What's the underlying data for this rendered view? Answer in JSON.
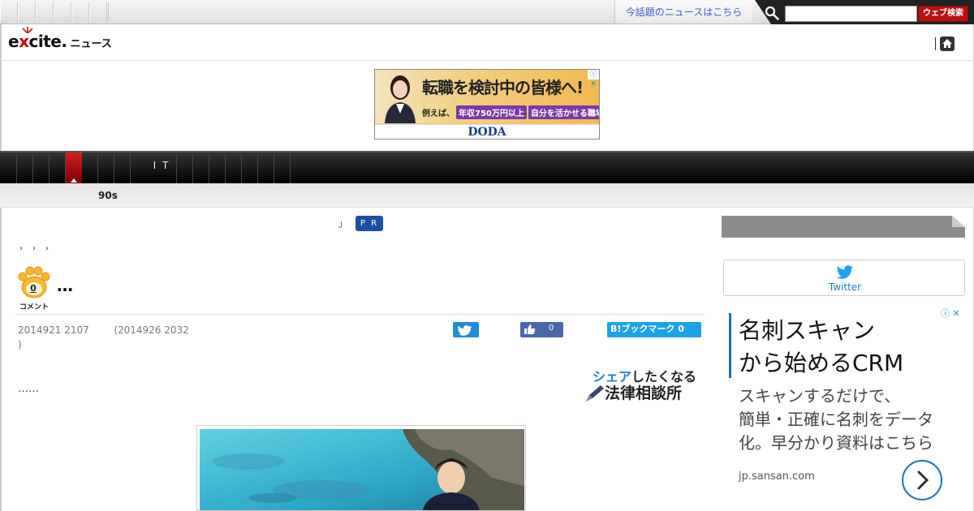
{
  "topbar": {
    "news_link": "今話題のニュースはこちら",
    "search_placeholder": "",
    "search_button": "ウェブ検索"
  },
  "logo": {
    "brand_pre": "e",
    "brand_x": "x",
    "brand_post": "cite",
    "brand_dot": ".",
    "section": "ニュース"
  },
  "banner": {
    "headline": "転職を検討中の皆様へ!",
    "sub_prefix": "例えば、",
    "sub_pill1": "年収750万円以上",
    "sub_pill2": "自分を活かせる職場",
    "brand": "DODA",
    "adchoice": "ⓘ ✕"
  },
  "nav": {
    "it_label": "I T"
  },
  "subnav": {
    "item": "90s"
  },
  "article": {
    "pr_mark": "┘",
    "pr_badge": "P R",
    "crumbs": [
      "›",
      "›",
      "›"
    ],
    "comment_count": "0",
    "comment_label": "コメント",
    "title": "…",
    "meta_line1": "2014921 2107",
    "meta_line2": "(2014926 2032",
    "meta_close": ")",
    "fb_count": "0",
    "hatena_label": "B!ブックマーク 0",
    "law_line1_a": "シェア",
    "law_line1_b": "したくなる",
    "law_line2": "法律相談所",
    "excerpt": "……"
  },
  "sidebar": {
    "twitter_label": "Twitter",
    "ad_title_line1": "名刺スキャン",
    "ad_title_line2": "から始めるCRM",
    "ad_body_line1": "スキャンするだけで、",
    "ad_body_line2": "簡単・正確に名刺をデータ",
    "ad_body_line3": "化。早分かり資料はこちら",
    "ad_url": "jp.sansan.com",
    "ad_choice": "ⓘ ✕"
  },
  "colors": {
    "brand_red": "#c80000",
    "link_blue": "#3a62c4",
    "nav_active": "#c81818",
    "twitter_blue": "#1f8dd6",
    "facebook_blue": "#4a68aa",
    "hatena_blue": "#1ea2e6"
  }
}
